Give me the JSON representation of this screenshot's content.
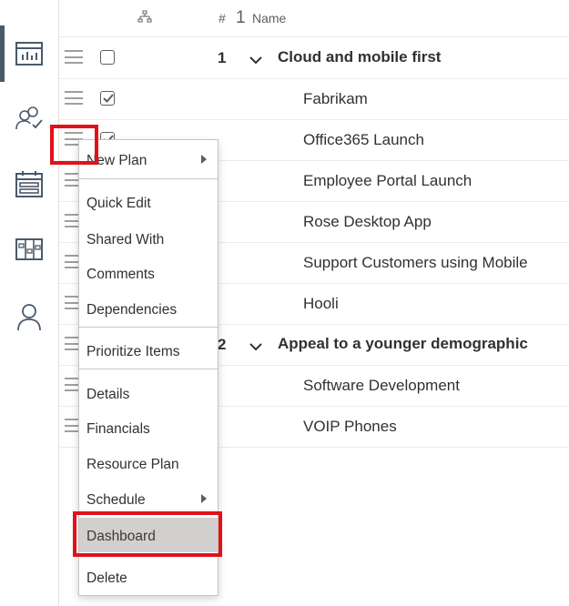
{
  "header": {
    "hash_label": "#",
    "sort_indicator": "1",
    "name_label": "Name"
  },
  "rail": {
    "icons": [
      "dashboard-icon",
      "people-check-icon",
      "calendar-icon",
      "board-icon",
      "person-icon"
    ]
  },
  "rows": [
    {
      "num": "1",
      "title": "Cloud and mobile first",
      "level": 0,
      "checked": false
    },
    {
      "title": "Fabrikam",
      "level": 1,
      "checked": true
    },
    {
      "title": "Office365 Launch",
      "level": 1,
      "checked": true
    },
    {
      "title": "Employee Portal Launch",
      "level": 1
    },
    {
      "title": "Rose Desktop App",
      "level": 1
    },
    {
      "title": "Support Customers using Mobile",
      "level": 1
    },
    {
      "title": "Hooli",
      "level": 1
    },
    {
      "num": "2",
      "title": "Appeal to a younger demographic",
      "level": 0
    },
    {
      "title": "Software Development",
      "level": 1
    },
    {
      "title": "VOIP Phones",
      "level": 1
    }
  ],
  "menu": {
    "new_plan": "New Plan",
    "quick_edit": "Quick Edit",
    "shared_with": "Shared With",
    "comments": "Comments",
    "dependencies": "Dependencies",
    "prioritize_items": "Prioritize Items",
    "details": "Details",
    "financials": "Financials",
    "resource_plan": "Resource Plan",
    "schedule": "Schedule",
    "dashboard": "Dashboard",
    "delete": "Delete"
  },
  "colors": {
    "highlight": "#e1111a",
    "active_rail": "#4a5a6a",
    "hover_item": "#d2d0ce"
  }
}
